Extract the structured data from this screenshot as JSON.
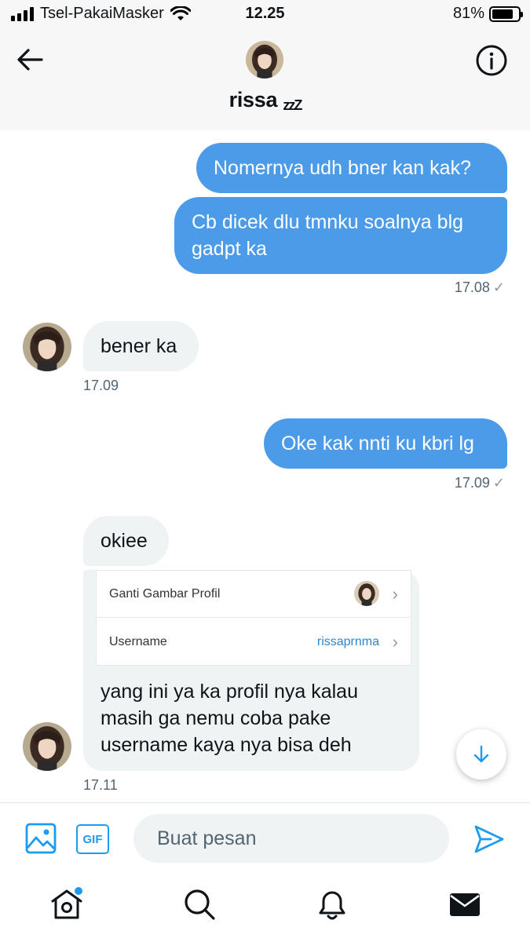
{
  "status_bar": {
    "carrier": "Tsel-PakaiMasker",
    "time": "12.25",
    "battery_text": "81%",
    "battery_level": 0.81
  },
  "header": {
    "name": "rissa",
    "name_suffix": "zzZ"
  },
  "messages": [
    {
      "direction": "out",
      "text": "Nomernya udh bner kan kak?"
    },
    {
      "direction": "out",
      "text": "Cb dicek dlu tmnku soalnya blg gadpt ka",
      "timestamp": "17.08",
      "status": "✓"
    },
    {
      "direction": "in",
      "text": "bener ka",
      "timestamp": "17.09"
    },
    {
      "direction": "out",
      "text": "Oke kak nnti ku kbri lg",
      "timestamp": "17.09",
      "status": "✓"
    },
    {
      "direction": "in",
      "text": "okiee"
    },
    {
      "direction": "in",
      "text": "yang ini ya ka profil nya kalau masih ga nemu coba pake username kaya nya bisa deh",
      "timestamp": "17.11"
    }
  ],
  "shared_card": {
    "row1_label": "Ganti Gambar Profil",
    "row2_label": "Username",
    "row2_value": "rissaprnma",
    "chevron": "›"
  },
  "composer": {
    "placeholder": "Buat pesan",
    "gif_label": "GIF"
  },
  "icons": {
    "back": "arrow-left-icon",
    "info": "info-icon",
    "image": "image-icon",
    "gif": "gif-icon",
    "send": "send-icon",
    "scroll_down": "arrow-down-icon",
    "home": "home-icon",
    "search": "search-icon",
    "notifications": "bell-icon",
    "messages": "mail-icon"
  },
  "colors": {
    "accent": "#1d9bf0",
    "outgoing_bubble": "#4c9be8",
    "incoming_bubble": "#eff3f4"
  }
}
